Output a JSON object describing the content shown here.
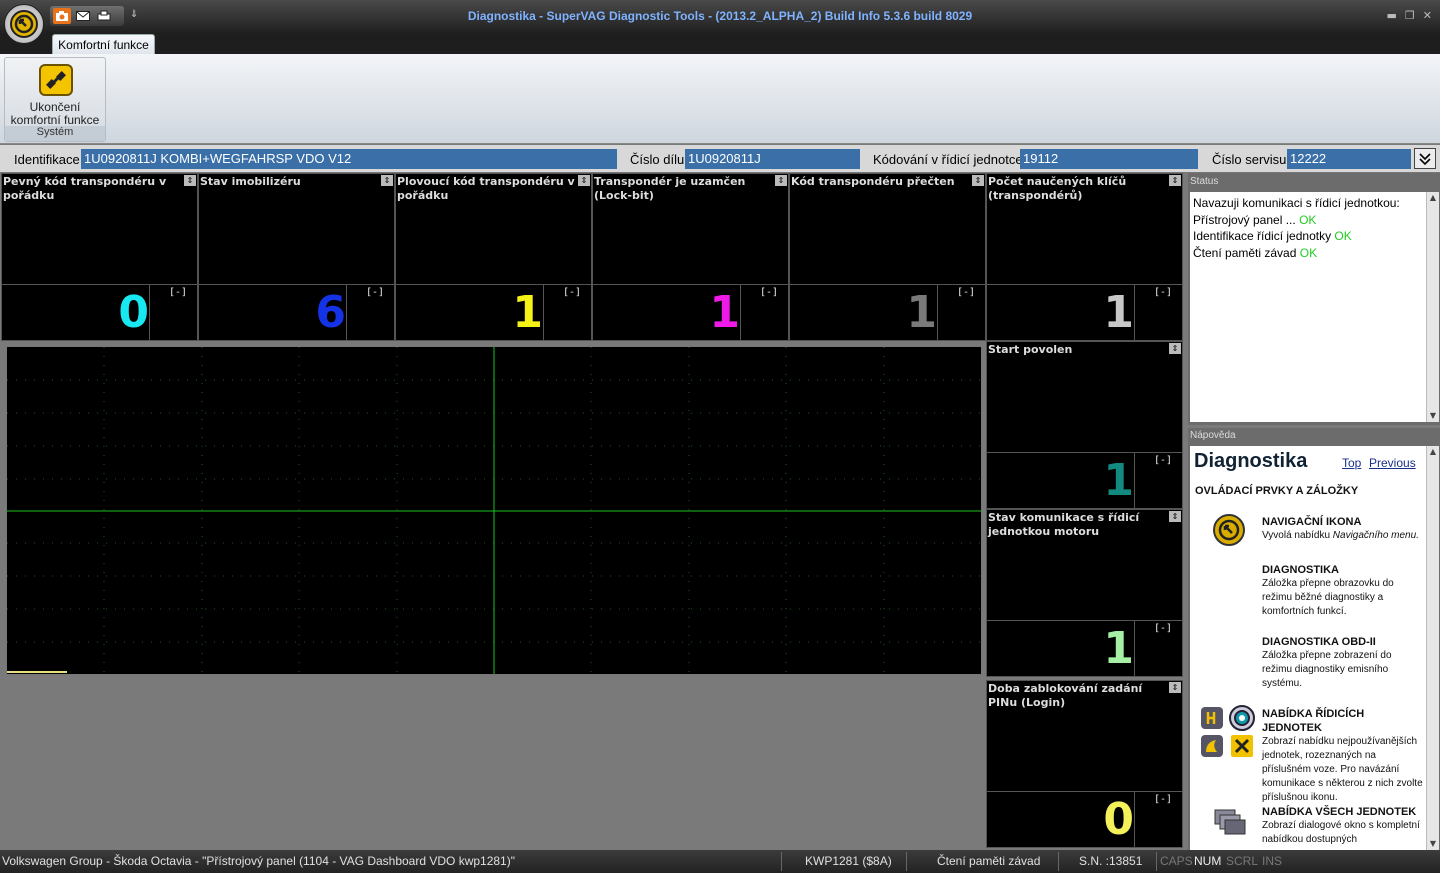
{
  "window": {
    "title": "Diagnostika - SuperVAG Diagnostic Tools -  (2013.2_ALPHA_2) Build Info 5.3.6 build 8029",
    "controls": {
      "minimize": "▬",
      "restore": "❐",
      "close": "✕"
    }
  },
  "quick_access": {
    "more": "⇓"
  },
  "ribbon": {
    "tab": "Komfortní funkce",
    "button_line1": "Ukončení",
    "button_line2": "komfortní funkce",
    "group": "Systém"
  },
  "info": {
    "ident_label": "Identifikace",
    "ident_value": "1U0920811J  KOMBI+WEGFAHRSP VDO V12",
    "part_label": "Číslo dílu",
    "part_value": "1U0920811J",
    "coding_label": "Kódování v řídicí jednotce",
    "coding_value": "19112",
    "service_label": "Číslo servisu",
    "service_value": "12222"
  },
  "gauges": [
    {
      "title": "Pevný kód transpondéru v pořádku",
      "value": "0",
      "color": "#18e8f0"
    },
    {
      "title": "Stav imobilizéru",
      "value": "6",
      "color": "#1432e6"
    },
    {
      "title": "Plovoucí kód transpondéru v pořádku",
      "value": "1",
      "color": "#f5f218"
    },
    {
      "title": "Transpondér je uzamčen (Lock-bit)",
      "value": "1",
      "color": "#f01ae8"
    },
    {
      "title": "Kód transpondéru přečten",
      "value": "1",
      "color": "#7a7a7a"
    },
    {
      "title": "Počet naučených klíčů (transpondérů)",
      "value": "1",
      "color": "#c8c8c8"
    },
    {
      "title": "Start povolen",
      "value": "1",
      "color": "#128a80"
    },
    {
      "title": "Stav komunikace s řídicí jednotkou motoru",
      "value": "1",
      "color": "#a6f0a6"
    },
    {
      "title": "Doba zablokování zadání PINu (Login)",
      "value": "0",
      "color": "#f4f05a"
    }
  ],
  "gauge_minmax_label": "[-]",
  "status": {
    "label": "Status",
    "line1": "Navazuji komunikaci s řídicí jednotkou:",
    "line2": "Přístrojový panel ...",
    "line3": "Identifikace řídicí jednotky",
    "line4": "Čtení paměti závad",
    "ok": "OK"
  },
  "help": {
    "label": "Nápověda",
    "heading": "Diagnostika",
    "link_top": "Top",
    "link_previous": "Previous",
    "subheading": "OVLÁDACÍ PRVKY A ZÁLOŽKY",
    "s1_title": "NAVIGAČNÍ IKONA",
    "s1_text": "Vyvolá nabídku",
    "s1_em": "Navigačního menu.",
    "s2_title": "DIAGNOSTIKA",
    "s2_text": "Záložka přepne obrazovku do režimu běžné diagnostiky a komfortních funkcí.",
    "s3_title": "DIAGNOSTIKA OBD-II",
    "s3_text": "Záložka přepne zobrazení do režimu diagnostiky emisního systému.",
    "s4_title": "NABÍDKA ŘÍDICÍCH JEDNOTEK",
    "s4_text": "Zobrazí nabídku nejpoužívanějších jednotek, rozeznaných na příslušném voze. Pro navázání komunikace s některou z nich zvolte příslušnou ikonu.",
    "s5_title": "NABÍDKA VŠECH JEDNOTEK",
    "s5_text": "Zobrazí dialogové okno s kompletní nabídkou dostupných"
  },
  "statusbar": {
    "vehicle": "Volkswagen Group - Škoda Octavia - \"Přístrojový panel (1104 - VAG Dashboard VDO kwp1281)\"",
    "protocol": "KWP1281 ($8A)",
    "operation": "Čtení paměti závad",
    "serial": "S.N. :13851",
    "caps": "CAPS",
    "num": "NUM",
    "scrl": "SCRL",
    "ins": "INS"
  },
  "colors": {
    "ok": "#22cc22",
    "field_bg": "#3a6fa8",
    "grid_line": "#1cc21c",
    "title_text": "#7fb3ff"
  },
  "icons": [
    "navigation-orb-icon",
    "camera-icon",
    "mail-icon",
    "print-icon",
    "plug-exit-icon",
    "dropdown-arrow-icon",
    "panel-toggle-icon"
  ]
}
